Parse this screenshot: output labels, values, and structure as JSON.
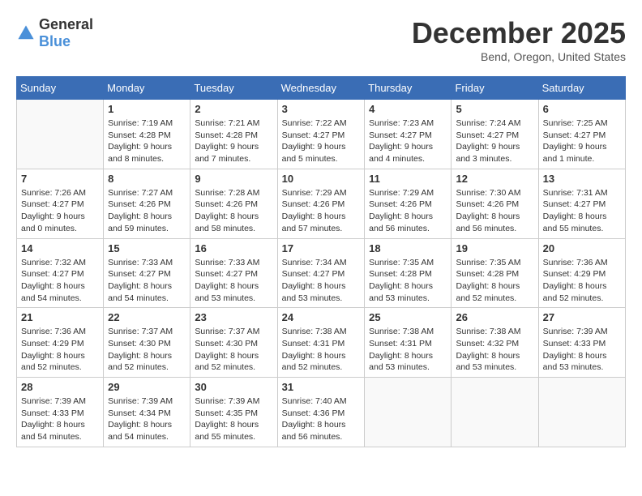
{
  "header": {
    "logo_general": "General",
    "logo_blue": "Blue",
    "month_title": "December 2025",
    "location": "Bend, Oregon, United States"
  },
  "days_of_week": [
    "Sunday",
    "Monday",
    "Tuesday",
    "Wednesday",
    "Thursday",
    "Friday",
    "Saturday"
  ],
  "weeks": [
    [
      {
        "day": "",
        "info": ""
      },
      {
        "day": "1",
        "info": "Sunrise: 7:19 AM\nSunset: 4:28 PM\nDaylight: 9 hours\nand 8 minutes."
      },
      {
        "day": "2",
        "info": "Sunrise: 7:21 AM\nSunset: 4:28 PM\nDaylight: 9 hours\nand 7 minutes."
      },
      {
        "day": "3",
        "info": "Sunrise: 7:22 AM\nSunset: 4:27 PM\nDaylight: 9 hours\nand 5 minutes."
      },
      {
        "day": "4",
        "info": "Sunrise: 7:23 AM\nSunset: 4:27 PM\nDaylight: 9 hours\nand 4 minutes."
      },
      {
        "day": "5",
        "info": "Sunrise: 7:24 AM\nSunset: 4:27 PM\nDaylight: 9 hours\nand 3 minutes."
      },
      {
        "day": "6",
        "info": "Sunrise: 7:25 AM\nSunset: 4:27 PM\nDaylight: 9 hours\nand 1 minute."
      }
    ],
    [
      {
        "day": "7",
        "info": "Sunrise: 7:26 AM\nSunset: 4:27 PM\nDaylight: 9 hours\nand 0 minutes."
      },
      {
        "day": "8",
        "info": "Sunrise: 7:27 AM\nSunset: 4:26 PM\nDaylight: 8 hours\nand 59 minutes."
      },
      {
        "day": "9",
        "info": "Sunrise: 7:28 AM\nSunset: 4:26 PM\nDaylight: 8 hours\nand 58 minutes."
      },
      {
        "day": "10",
        "info": "Sunrise: 7:29 AM\nSunset: 4:26 PM\nDaylight: 8 hours\nand 57 minutes."
      },
      {
        "day": "11",
        "info": "Sunrise: 7:29 AM\nSunset: 4:26 PM\nDaylight: 8 hours\nand 56 minutes."
      },
      {
        "day": "12",
        "info": "Sunrise: 7:30 AM\nSunset: 4:26 PM\nDaylight: 8 hours\nand 56 minutes."
      },
      {
        "day": "13",
        "info": "Sunrise: 7:31 AM\nSunset: 4:27 PM\nDaylight: 8 hours\nand 55 minutes."
      }
    ],
    [
      {
        "day": "14",
        "info": "Sunrise: 7:32 AM\nSunset: 4:27 PM\nDaylight: 8 hours\nand 54 minutes."
      },
      {
        "day": "15",
        "info": "Sunrise: 7:33 AM\nSunset: 4:27 PM\nDaylight: 8 hours\nand 54 minutes."
      },
      {
        "day": "16",
        "info": "Sunrise: 7:33 AM\nSunset: 4:27 PM\nDaylight: 8 hours\nand 53 minutes."
      },
      {
        "day": "17",
        "info": "Sunrise: 7:34 AM\nSunset: 4:27 PM\nDaylight: 8 hours\nand 53 minutes."
      },
      {
        "day": "18",
        "info": "Sunrise: 7:35 AM\nSunset: 4:28 PM\nDaylight: 8 hours\nand 53 minutes."
      },
      {
        "day": "19",
        "info": "Sunrise: 7:35 AM\nSunset: 4:28 PM\nDaylight: 8 hours\nand 52 minutes."
      },
      {
        "day": "20",
        "info": "Sunrise: 7:36 AM\nSunset: 4:29 PM\nDaylight: 8 hours\nand 52 minutes."
      }
    ],
    [
      {
        "day": "21",
        "info": "Sunrise: 7:36 AM\nSunset: 4:29 PM\nDaylight: 8 hours\nand 52 minutes."
      },
      {
        "day": "22",
        "info": "Sunrise: 7:37 AM\nSunset: 4:30 PM\nDaylight: 8 hours\nand 52 minutes."
      },
      {
        "day": "23",
        "info": "Sunrise: 7:37 AM\nSunset: 4:30 PM\nDaylight: 8 hours\nand 52 minutes."
      },
      {
        "day": "24",
        "info": "Sunrise: 7:38 AM\nSunset: 4:31 PM\nDaylight: 8 hours\nand 52 minutes."
      },
      {
        "day": "25",
        "info": "Sunrise: 7:38 AM\nSunset: 4:31 PM\nDaylight: 8 hours\nand 53 minutes."
      },
      {
        "day": "26",
        "info": "Sunrise: 7:38 AM\nSunset: 4:32 PM\nDaylight: 8 hours\nand 53 minutes."
      },
      {
        "day": "27",
        "info": "Sunrise: 7:39 AM\nSunset: 4:33 PM\nDaylight: 8 hours\nand 53 minutes."
      }
    ],
    [
      {
        "day": "28",
        "info": "Sunrise: 7:39 AM\nSunset: 4:33 PM\nDaylight: 8 hours\nand 54 minutes."
      },
      {
        "day": "29",
        "info": "Sunrise: 7:39 AM\nSunset: 4:34 PM\nDaylight: 8 hours\nand 54 minutes."
      },
      {
        "day": "30",
        "info": "Sunrise: 7:39 AM\nSunset: 4:35 PM\nDaylight: 8 hours\nand 55 minutes."
      },
      {
        "day": "31",
        "info": "Sunrise: 7:40 AM\nSunset: 4:36 PM\nDaylight: 8 hours\nand 56 minutes."
      },
      {
        "day": "",
        "info": ""
      },
      {
        "day": "",
        "info": ""
      },
      {
        "day": "",
        "info": ""
      }
    ]
  ]
}
